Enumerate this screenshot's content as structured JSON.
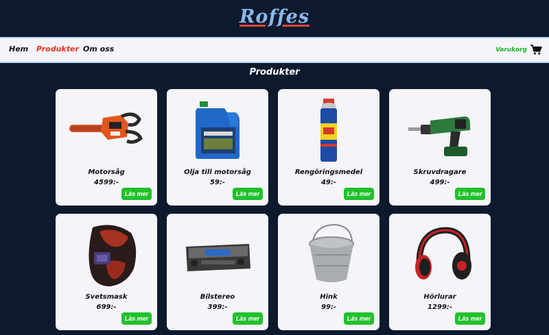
{
  "header": {
    "logo": "Roffes"
  },
  "nav": {
    "home": "Hem",
    "products": "Produkter",
    "about": "Om oss",
    "cart": "Varukorg",
    "active_color": "#e8321f",
    "cart_color": "#1eb52a"
  },
  "main": {
    "title": "Produkter",
    "products": [
      {
        "name": "Motorsåg",
        "price": "4599:-",
        "button": "Läs mer",
        "icon": "chainsaw-icon"
      },
      {
        "name": "Olja till motorsåg",
        "price": "59:-",
        "button": "Läs mer",
        "icon": "oil-can-icon"
      },
      {
        "name": "Rengöringsmedel",
        "price": "49:-",
        "button": "Läs mer",
        "icon": "spray-can-icon"
      },
      {
        "name": "Skruvdragare",
        "price": "499:-",
        "button": "Läs mer",
        "icon": "drill-icon"
      },
      {
        "name": "Svetsmask",
        "price": "699:-",
        "button": "Läs mer",
        "icon": "welding-mask-icon"
      },
      {
        "name": "Bilstereo",
        "price": "399:-",
        "button": "Läs mer",
        "icon": "car-stereo-icon"
      },
      {
        "name": "Hink",
        "price": "99:-",
        "button": "Läs mer",
        "icon": "bucket-icon"
      },
      {
        "name": "Hörlurar",
        "price": "1299:-",
        "button": "Läs mer",
        "icon": "headphones-icon"
      }
    ]
  },
  "colors": {
    "background": "#0d1a2e",
    "card": "#f4f4f9",
    "button": "#21c12b",
    "logo": "#8ab8ea"
  }
}
